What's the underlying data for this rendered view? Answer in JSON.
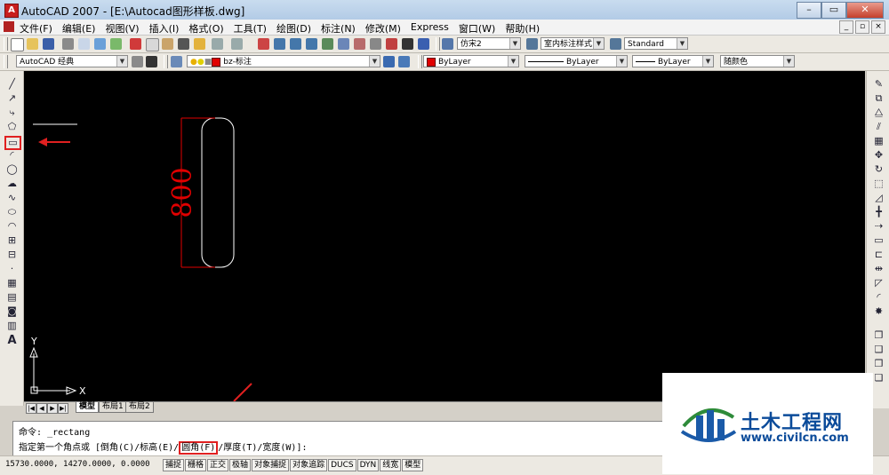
{
  "window": {
    "title": "AutoCAD 2007 - [E:\\Autocad图形样板.dwg]",
    "app_icon": "autocad-logo-icon",
    "controls": [
      "minimize",
      "maximize",
      "close"
    ]
  },
  "menubar": {
    "items": [
      "文件(F)",
      "编辑(E)",
      "视图(V)",
      "插入(I)",
      "格式(O)",
      "工具(T)",
      "绘图(D)",
      "标注(N)",
      "修改(M)",
      "Express",
      "窗口(W)",
      "帮助(H)"
    ]
  },
  "toolbar_standard": {
    "text_style": "仿宋2",
    "dim_style": "室内标注样式",
    "table_style": "Standard"
  },
  "toolbar_layers": {
    "workspace": "AutoCAD 经典",
    "layer": "bz-标注",
    "color": "ByLayer",
    "linetype": "ByLayer",
    "lineweight": "ByLayer",
    "plotstyle": "随颜色"
  },
  "drawing": {
    "dimension_text": "800",
    "dimension_color": "#e00000",
    "ucs_x_label": "X",
    "ucs_y_label": "Y"
  },
  "layout_tabs": {
    "tabs": [
      "模型",
      "布局1",
      "布局2"
    ],
    "active": "模型"
  },
  "command": {
    "line1_prefix": "命令:",
    "line1_value": "_rectang",
    "line2_before": "指定第一个角点或 [倒角(C)/标高(E)/",
    "line2_highlight": "圆角(F)",
    "line2_after": "/厚度(T)/宽度(W)]:"
  },
  "status": {
    "coordinates": "15730.0000, 14270.0000, 0.0000",
    "toggles": [
      "捕捉",
      "栅格",
      "正交",
      "极轴",
      "对象捕捉",
      "对象追踪",
      "DUCS",
      "DYN",
      "线宽",
      "模型"
    ]
  },
  "watermark": {
    "title": "土木工程网",
    "url": "www.civilcn.com"
  },
  "annotation_color": "#e02020"
}
